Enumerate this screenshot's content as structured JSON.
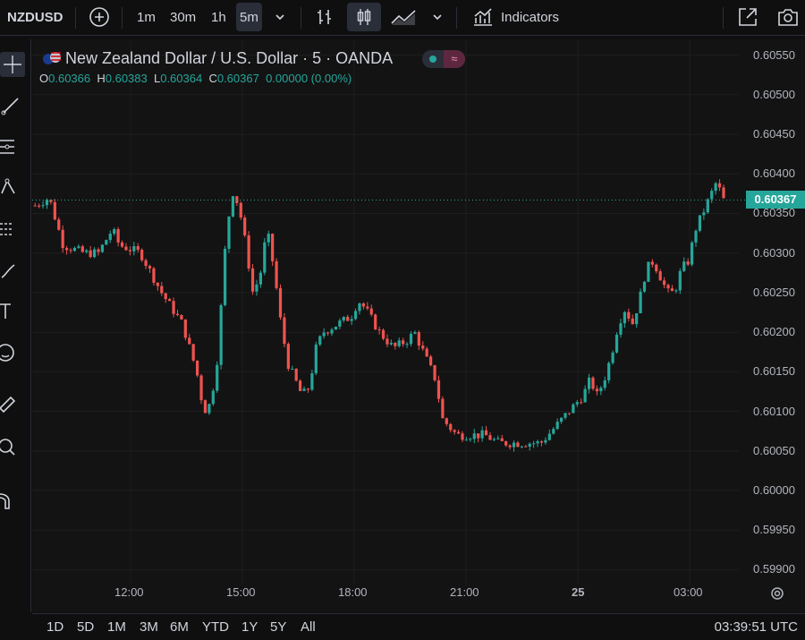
{
  "toolbar": {
    "symbol": "NZDUSD",
    "intervals": [
      "1m",
      "30m",
      "1h",
      "5m"
    ],
    "selected_interval": "5m",
    "indicators_label": "Indicators"
  },
  "legend": {
    "title": "New Zealand Dollar / U.S. Dollar · 5 · OANDA",
    "o_label": "O",
    "o_value": "0.60366",
    "h_label": "H",
    "h_value": "0.60383",
    "l_label": "L",
    "l_value": "0.60364",
    "c_label": "C",
    "c_value": "0.60367",
    "change": "0.00000 (0.00%)"
  },
  "colors": {
    "up": "#26a69a",
    "down": "#ef5350",
    "background": "#131313",
    "last_price": "#26a69a"
  },
  "chart_data": {
    "type": "candlestick",
    "price_labels": [
      "0.60550",
      "0.60500",
      "0.60450",
      "0.60400",
      "0.60350",
      "0.60300",
      "0.60250",
      "0.60200",
      "0.60150",
      "0.60100",
      "0.60050",
      "0.60000",
      "0.59950",
      "0.59900"
    ],
    "time_labels": [
      "12:00",
      "15:00",
      "18:00",
      "21:00",
      "25",
      "03:00"
    ],
    "last_price": "0.60367",
    "ylim": [
      0.5988,
      0.6057
    ],
    "close_path": [
      [
        0.0,
        0.6036
      ],
      [
        0.02,
        0.6037
      ],
      [
        0.04,
        0.6031
      ],
      [
        0.07,
        0.603
      ],
      [
        0.09,
        0.603
      ],
      [
        0.11,
        0.6033
      ],
      [
        0.12,
        0.6031
      ],
      [
        0.15,
        0.603
      ],
      [
        0.18,
        0.6025
      ],
      [
        0.21,
        0.6021
      ],
      [
        0.23,
        0.6015
      ],
      [
        0.24,
        0.601
      ],
      [
        0.25,
        0.6011
      ],
      [
        0.26,
        0.6017
      ],
      [
        0.27,
        0.603
      ],
      [
        0.28,
        0.6038
      ],
      [
        0.29,
        0.6036
      ],
      [
        0.3,
        0.6031
      ],
      [
        0.31,
        0.6025
      ],
      [
        0.32,
        0.6027
      ],
      [
        0.33,
        0.6033
      ],
      [
        0.34,
        0.6028
      ],
      [
        0.35,
        0.6021
      ],
      [
        0.36,
        0.6016
      ],
      [
        0.37,
        0.6014
      ],
      [
        0.38,
        0.6012
      ],
      [
        0.39,
        0.6013
      ],
      [
        0.4,
        0.6018
      ],
      [
        0.41,
        0.602
      ],
      [
        0.43,
        0.6021
      ],
      [
        0.45,
        0.6022
      ],
      [
        0.46,
        0.6024
      ],
      [
        0.47,
        0.6023
      ],
      [
        0.49,
        0.602
      ],
      [
        0.51,
        0.6018
      ],
      [
        0.53,
        0.6019
      ],
      [
        0.54,
        0.602
      ],
      [
        0.56,
        0.6016
      ],
      [
        0.57,
        0.6014
      ],
      [
        0.58,
        0.6009
      ],
      [
        0.59,
        0.6008
      ],
      [
        0.6,
        0.6007
      ],
      [
        0.62,
        0.6007
      ],
      [
        0.64,
        0.6007
      ],
      [
        0.66,
        0.6006
      ],
      [
        0.68,
        0.6006
      ],
      [
        0.69,
        0.6006
      ],
      [
        0.7,
        0.6006
      ],
      [
        0.72,
        0.6006
      ],
      [
        0.74,
        0.6008
      ],
      [
        0.76,
        0.601
      ],
      [
        0.78,
        0.6012
      ],
      [
        0.79,
        0.6014
      ],
      [
        0.8,
        0.6012
      ],
      [
        0.81,
        0.6014
      ],
      [
        0.82,
        0.6017
      ],
      [
        0.83,
        0.6021
      ],
      [
        0.84,
        0.6023
      ],
      [
        0.85,
        0.6021
      ],
      [
        0.86,
        0.6024
      ],
      [
        0.87,
        0.6028
      ],
      [
        0.88,
        0.6029
      ],
      [
        0.89,
        0.6027
      ],
      [
        0.9,
        0.6025
      ],
      [
        0.91,
        0.6025
      ],
      [
        0.92,
        0.6028
      ],
      [
        0.93,
        0.6029
      ],
      [
        0.94,
        0.6033
      ],
      [
        0.96,
        0.6037
      ],
      [
        0.97,
        0.6039
      ],
      [
        0.98,
        0.60367
      ]
    ]
  },
  "bottom": {
    "ranges": [
      "1D",
      "5D",
      "1M",
      "3M",
      "6M",
      "YTD",
      "1Y",
      "5Y",
      "All"
    ],
    "clock": "03:39:51 UTC"
  }
}
